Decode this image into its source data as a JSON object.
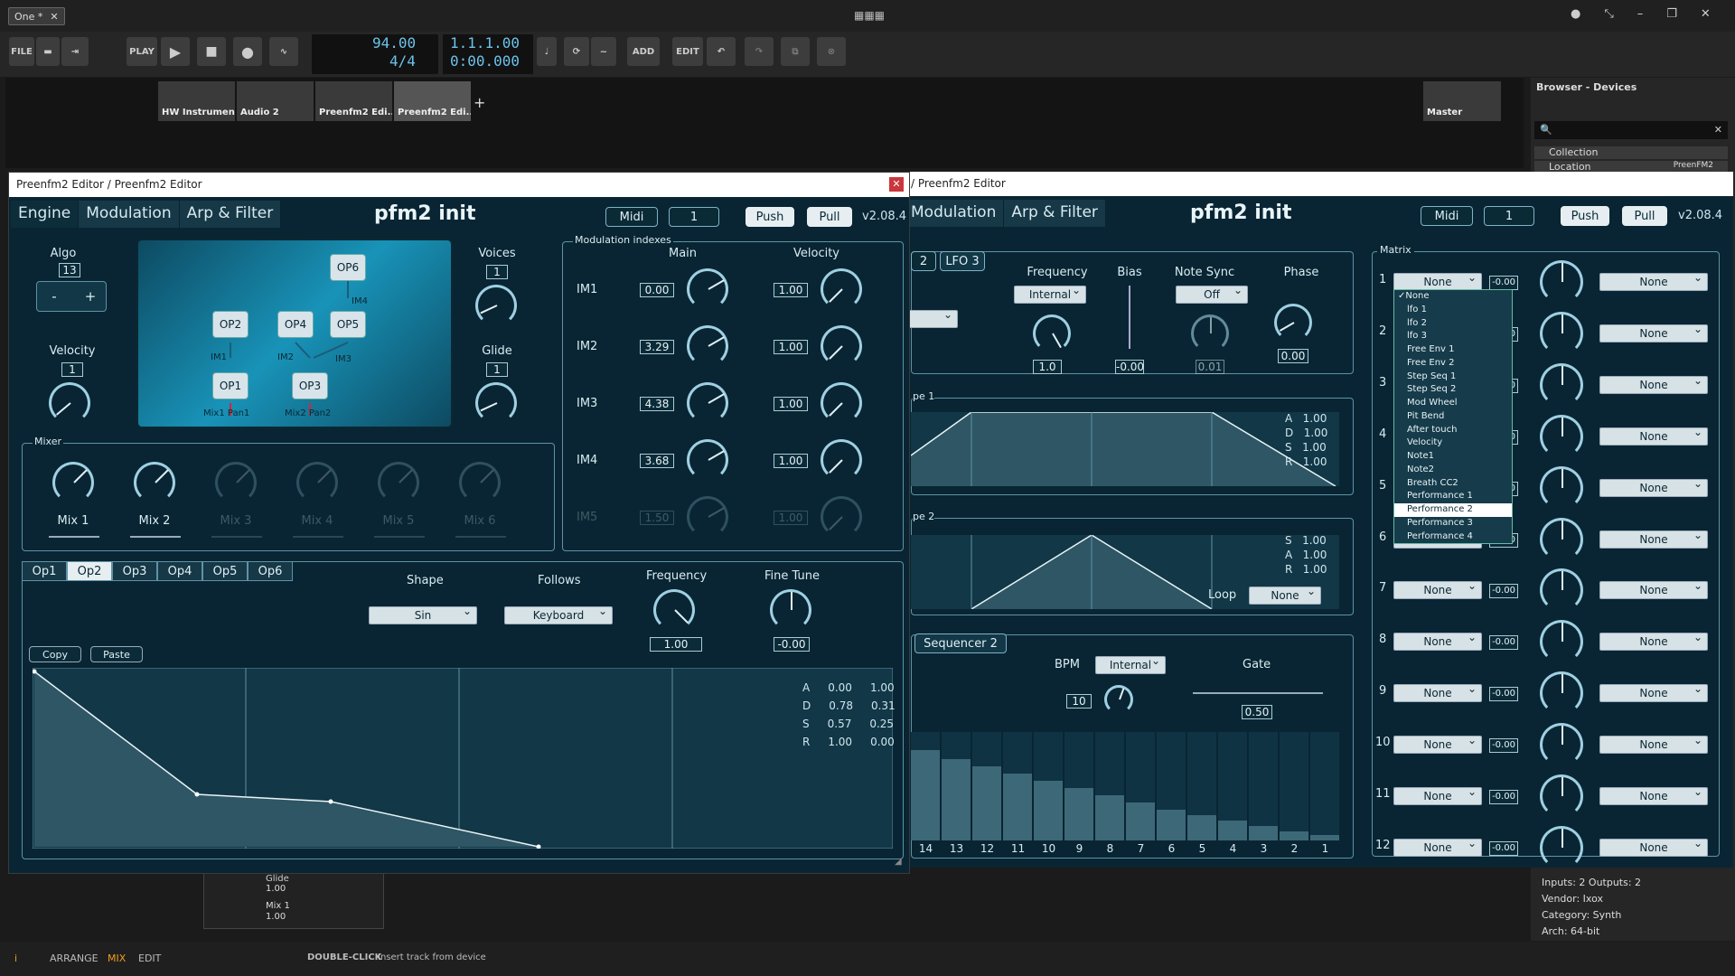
{
  "daw": {
    "doc_tab": "One *",
    "file": "FILE",
    "play": "PLAY",
    "add": "ADD",
    "edit": "EDIT",
    "tempo": "94.00",
    "signature": "4/4",
    "position": "1.1.1.00",
    "time": "0:00.000",
    "tracks": [
      "HW Instrument",
      "Audio 2",
      "Preenfm2 Edi...",
      "Preenfm2 Edi..."
    ],
    "master": "Master",
    "browser_title": "Browser - Devices",
    "collection": "Collection",
    "location": "Location",
    "location_val": "PreenFM2",
    "info": [
      "Inputs: 2   Outputs: 2",
      "Vendor: Ixox",
      "Category: Synth",
      "Arch: 64-bit"
    ],
    "bottom": {
      "arrange": "ARRANGE",
      "mix": "MIX",
      "edit": "EDIT",
      "dbl": "DOUBLE-CLICK",
      "hint": "Insert track from device"
    },
    "mini": [
      {
        "label": "Glide",
        "value": "1.00"
      },
      {
        "label": "Mix 1",
        "value": "1.00"
      }
    ]
  },
  "left": {
    "title": "Preenfm2 Editor / Preenfm2 Editor",
    "tabs": [
      "Engine",
      "Modulation",
      "Arp & Filter"
    ],
    "preset": "pfm2 init",
    "midi": "Midi",
    "channel": "1",
    "push": "Push",
    "pull": "Pull",
    "version": "v2.08.4",
    "algo_label": "Algo",
    "algo": "13",
    "minus": "-",
    "plus": "+",
    "velocity_label": "Velocity",
    "velocity": "1",
    "voices_label": "Voices",
    "voices": "1",
    "glide_label": "Glide",
    "glide": "1",
    "ops": [
      "OP6",
      "OP2",
      "OP4",
      "OP5",
      "OP1",
      "OP3"
    ],
    "im_labels": [
      "IM4",
      "IM1",
      "IM2",
      "IM3"
    ],
    "mix_pan": [
      "Mix1 Pan1",
      "Mix2 Pan2"
    ],
    "mixer_label": "Mixer",
    "mixers": [
      "Mix 1",
      "Mix 2",
      "Mix 3",
      "Mix 4",
      "Mix 5",
      "Mix 6"
    ],
    "modidx_label": "Modulation indexes",
    "main_label": "Main",
    "vel_label": "Velocity",
    "im": [
      {
        "n": "IM1",
        "main": "0.00",
        "vel": "1.00"
      },
      {
        "n": "IM2",
        "main": "3.29",
        "vel": "1.00"
      },
      {
        "n": "IM3",
        "main": "4.38",
        "vel": "1.00"
      },
      {
        "n": "IM4",
        "main": "3.68",
        "vel": "1.00"
      },
      {
        "n": "IM5",
        "main": "1.50",
        "vel": "1.00"
      }
    ],
    "optabs": [
      "Op1",
      "Op2",
      "Op3",
      "Op4",
      "Op5",
      "Op6"
    ],
    "shape_label": "Shape",
    "shape": "Sin",
    "follows_label": "Follows",
    "follows": "Keyboard",
    "freq_label": "Frequency",
    "freq": "1.00",
    "fine_label": "Fine Tune",
    "fine": "-0.00",
    "copy": "Copy",
    "paste": "Paste",
    "adsr": [
      [
        "A",
        "0.00",
        "1.00"
      ],
      [
        "D",
        "0.78",
        "0.31"
      ],
      [
        "S",
        "0.57",
        "0.25"
      ],
      [
        "R",
        "1.00",
        "0.00"
      ]
    ]
  },
  "right": {
    "title": "/ Preenfm2 Editor",
    "tabs": [
      "Modulation",
      "Arp & Filter"
    ],
    "preset": "pfm2 init",
    "midi": "Midi",
    "channel": "1",
    "push": "Push",
    "pull": "Pull",
    "version": "v2.08.4",
    "lfo_tabs": [
      "2",
      "LFO 3"
    ],
    "frequency_label": "Frequency",
    "frequency": "Internal",
    "bias_label": "Bias",
    "note_sync_label": "Note Sync",
    "note_sync": "Off",
    "phase_label": "Phase",
    "lfo_freq": "1.0",
    "bias": "-0.00",
    "sync_val": "0.01",
    "phase": "0.00",
    "env1_label": "pe 1",
    "env1": [
      [
        "A",
        "1.00"
      ],
      [
        "D",
        "1.00"
      ],
      [
        "S",
        "1.00"
      ],
      [
        "R",
        "1.00"
      ]
    ],
    "env2_label": "pe 2",
    "env2": [
      [
        "S",
        "1.00"
      ],
      [
        "A",
        "1.00"
      ],
      [
        "R",
        "1.00"
      ]
    ],
    "loop_label": "Loop",
    "loop": "None",
    "seq_tab": "Sequencer 2",
    "bpm_label": "BPM",
    "bpm": "Internal",
    "bpm_val": "10",
    "gate_label": "Gate",
    "gate": "0.50",
    "steps": [
      "14",
      "13",
      "12",
      "11",
      "10",
      "9",
      "8",
      "7",
      "6",
      "5",
      "4",
      "3",
      "2",
      "1"
    ],
    "matrix_label": "Matrix",
    "matrix_rows": [
      "1",
      "2",
      "3",
      "4",
      "5",
      "6",
      "7",
      "8",
      "9",
      "10",
      "11",
      "12"
    ],
    "matrix_src": "None",
    "matrix_amt": "-0.00",
    "matrix_dst": "None",
    "dropdown": [
      "None",
      "lfo 1",
      "lfo 2",
      "lfo 3",
      "Free Env 1",
      "Free Env 2",
      "Step Seq 1",
      "Step Seq 2",
      "Mod Wheel",
      "Pit Bend",
      "After touch",
      "Velocity",
      "Note1",
      "Note2",
      "Breath CC2",
      "Performance 1",
      "Performance 2",
      "Performance 3",
      "Performance 4"
    ],
    "dropdown_selected": "Performance 2"
  }
}
